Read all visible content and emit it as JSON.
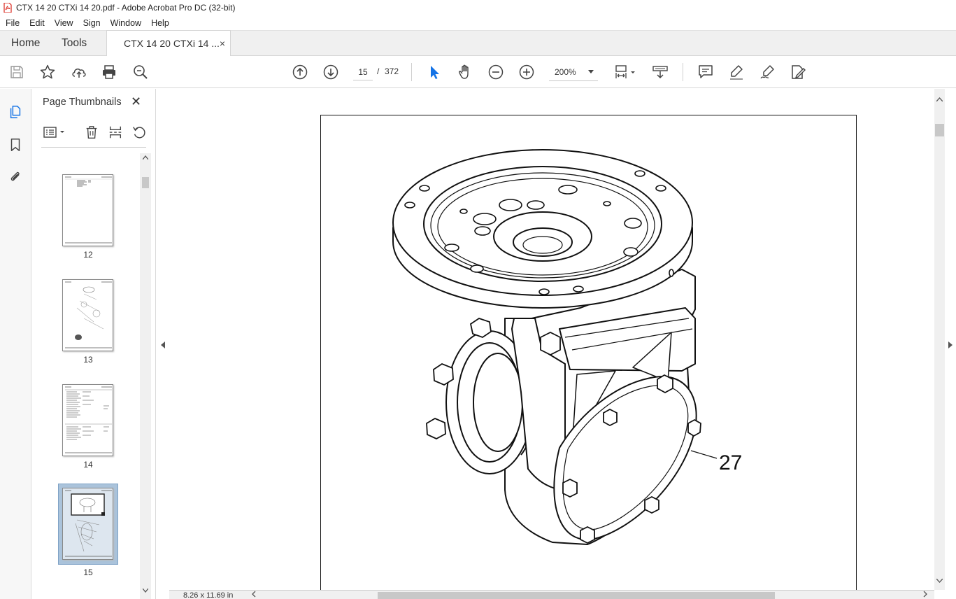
{
  "window": {
    "title": "CTX 14 20 CTXi 14 20.pdf - Adobe Acrobat Pro DC (32-bit)",
    "accent_color": "#1473e6",
    "app_icon_color": "#d9261c"
  },
  "menubar": {
    "items": [
      {
        "label": "File"
      },
      {
        "label": "Edit"
      },
      {
        "label": "View"
      },
      {
        "label": "Sign"
      },
      {
        "label": "Window"
      },
      {
        "label": "Help"
      }
    ]
  },
  "tabs": {
    "home_label": "Home",
    "tools_label": "Tools",
    "document_label": "CTX 14 20 CTXi 14 ...",
    "close_glyph": "×"
  },
  "toolbar": {
    "left_icons": [
      "save-icon",
      "star-icon",
      "upload-cloud-icon",
      "print-icon",
      "zoom-search-icon"
    ],
    "nav_icons": [
      "prev-page-icon",
      "next-page-icon"
    ],
    "current_page": "15",
    "page_separator": "/",
    "total_pages": "372",
    "tool_icons": [
      "select-cursor-icon",
      "hand-icon",
      "zoom-out-icon",
      "zoom-in-icon"
    ],
    "zoom_value": "200%",
    "view_icons": [
      "page-fit-icon",
      "scroll-mode-icon"
    ],
    "annotate_icons": [
      "comment-icon",
      "highlight-icon",
      "sign-pen-icon",
      "edit-pdf-icon"
    ]
  },
  "left_rail": {
    "icons": [
      "page-thumbnails-icon",
      "bookmark-icon",
      "attachment-icon"
    ]
  },
  "thumbnails_panel": {
    "title": "Page Thumbnails",
    "close_glyph": "✕",
    "tool_icons": [
      "options-menu-icon",
      "delete-icon",
      "insert-page-icon",
      "rotate-icon"
    ],
    "pages": [
      {
        "label": "12",
        "selected": false
      },
      {
        "label": "13",
        "selected": false
      },
      {
        "label": "14",
        "selected": false
      },
      {
        "label": "15",
        "selected": true
      }
    ]
  },
  "document": {
    "callout_number": "27",
    "page_size": "8.26 x 11.69 in"
  }
}
